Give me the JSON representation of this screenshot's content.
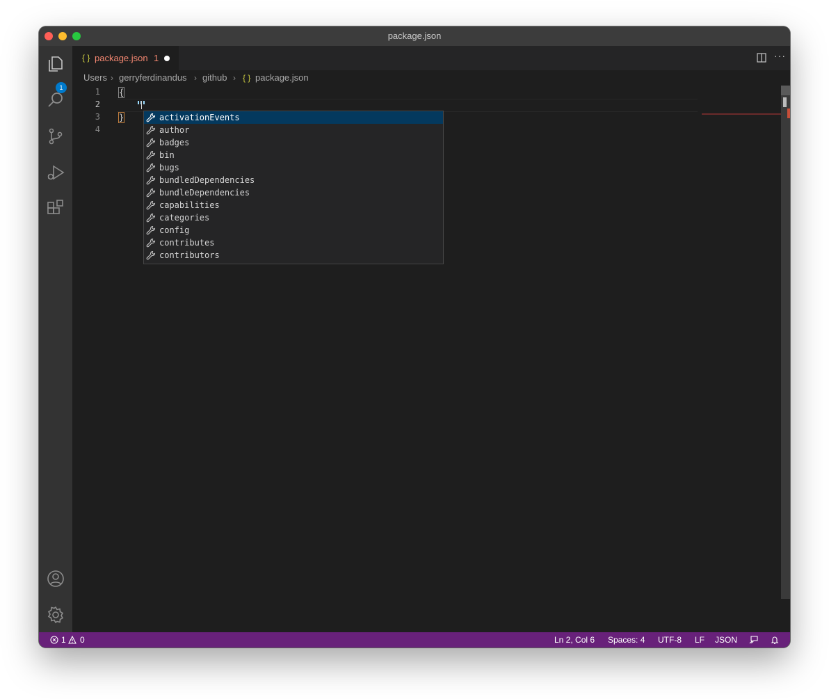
{
  "window": {
    "title": "package.json"
  },
  "activity_bar": {
    "explorer_badge": "1",
    "items": [
      "explorer-icon",
      "search-icon",
      "source-control-icon",
      "run-debug-icon",
      "extensions-icon",
      "account-icon",
      "gear-icon"
    ]
  },
  "tab": {
    "braces": "{ }",
    "name": "package.json",
    "problem_count": "1"
  },
  "breadcrumbs": {
    "parts": [
      "Users",
      "gerryferdinandus",
      "github"
    ],
    "braces": "{ }",
    "file": "package.json"
  },
  "editor": {
    "line_numbers": [
      "1",
      "2",
      "3",
      "4"
    ],
    "lines": [
      "{",
      "    ",
      "}",
      ""
    ]
  },
  "suggestions": {
    "selected_index": 0,
    "items": [
      "activationEvents",
      "author",
      "badges",
      "bin",
      "bugs",
      "bundledDependencies",
      "bundleDependencies",
      "capabilities",
      "categories",
      "config",
      "contributes",
      "contributors"
    ]
  },
  "status": {
    "errors": "1",
    "warnings": "0",
    "position": "Ln 2, Col 6",
    "spaces": "Spaces: 4",
    "encoding": "UTF-8",
    "eol": "LF",
    "language": "JSON"
  },
  "colors": {
    "status_bar": "#68217a",
    "selection": "#04395e",
    "accent": "#007acc"
  }
}
